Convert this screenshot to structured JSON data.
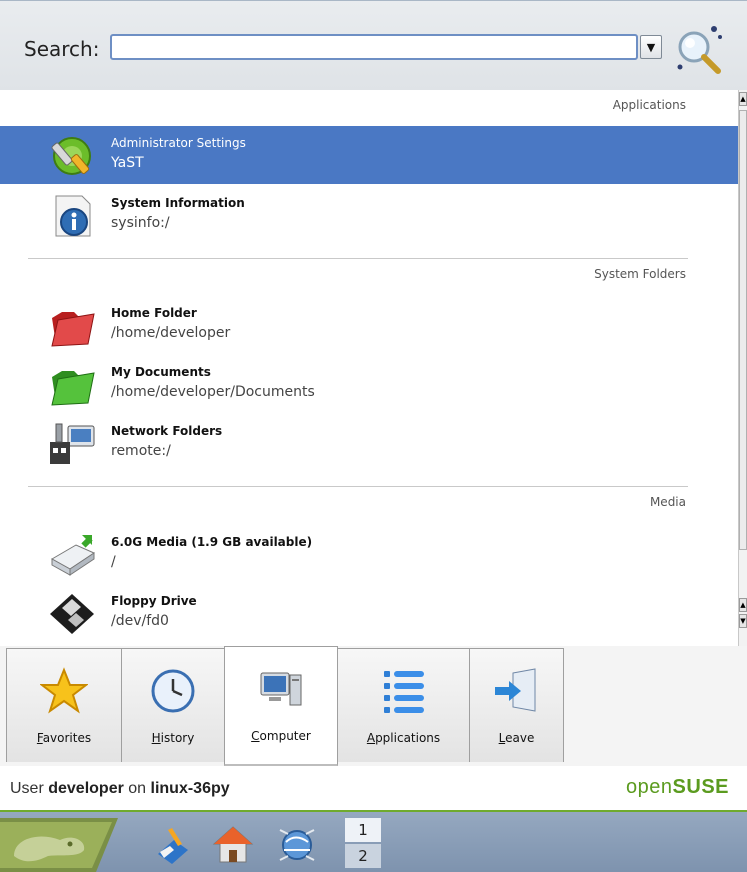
{
  "search": {
    "label": "Search:",
    "value": "",
    "placeholder": ""
  },
  "sections": [
    {
      "header": "Applications",
      "items": [
        {
          "title": "Administrator Settings",
          "subtitle": "YaST",
          "icon": "yast-icon",
          "selected": true
        },
        {
          "title": "System Information",
          "subtitle": "sysinfo:/",
          "icon": "system-info-icon",
          "selected": false
        }
      ]
    },
    {
      "header": "System Folders",
      "items": [
        {
          "title": "Home Folder",
          "subtitle": "/home/developer",
          "icon": "red-folder-icon"
        },
        {
          "title": "My Documents",
          "subtitle": "/home/developer/Documents",
          "icon": "green-folder-icon"
        },
        {
          "title": "Network Folders",
          "subtitle": "remote:/",
          "icon": "network-folder-icon"
        }
      ]
    },
    {
      "header": "Media",
      "items": [
        {
          "title": "6.0G Media (1.9 GB available)",
          "subtitle": "/",
          "icon": "drive-icon"
        },
        {
          "title": "Floppy Drive",
          "subtitle": "/dev/fd0",
          "icon": "floppy-icon"
        }
      ]
    }
  ],
  "tabs": [
    {
      "key": "F",
      "rest": "avorites",
      "icon": "star-icon",
      "active": false
    },
    {
      "key": "H",
      "rest": "istory",
      "icon": "clock-icon",
      "active": false
    },
    {
      "key": "C",
      "rest": "omputer",
      "icon": "computer-icon",
      "active": true
    },
    {
      "key": "A",
      "rest": "pplications",
      "icon": "applications-icon",
      "active": false
    },
    {
      "key": "L",
      "rest": "eave",
      "icon": "leave-icon",
      "active": false
    }
  ],
  "footer": {
    "prefix": "User ",
    "user": "developer",
    "middle": " on ",
    "host": "linux-36py",
    "brand_light": "open",
    "brand_bold": "SUSE"
  },
  "taskbar": {
    "pager": [
      "1",
      "2"
    ]
  },
  "colors": {
    "selection": "#4a78c4",
    "brand_green": "#5b9b1f"
  }
}
